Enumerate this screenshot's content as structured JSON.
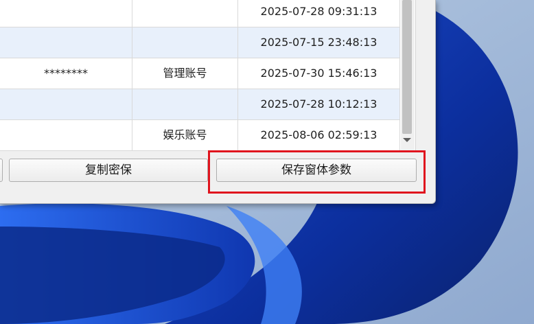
{
  "table": {
    "rows": [
      {
        "password": "",
        "type": "",
        "time": "2025-07-28 09:31:13"
      },
      {
        "password": "",
        "type": "",
        "time": "2025-07-15 23:48:13"
      },
      {
        "password": "********",
        "type": "管理账号",
        "time": "2025-07-30 15:46:13"
      },
      {
        "password": "",
        "type": "",
        "time": "2025-07-28 10:12:13"
      },
      {
        "password": "",
        "type": "娱乐账号",
        "time": "2025-08-06 02:59:13"
      }
    ]
  },
  "buttons": {
    "copy_security": "复制密保",
    "save_window_params": "保存窗体参数"
  },
  "colors": {
    "highlight": "#e0141e",
    "row_alt": "#e8f0fb"
  }
}
